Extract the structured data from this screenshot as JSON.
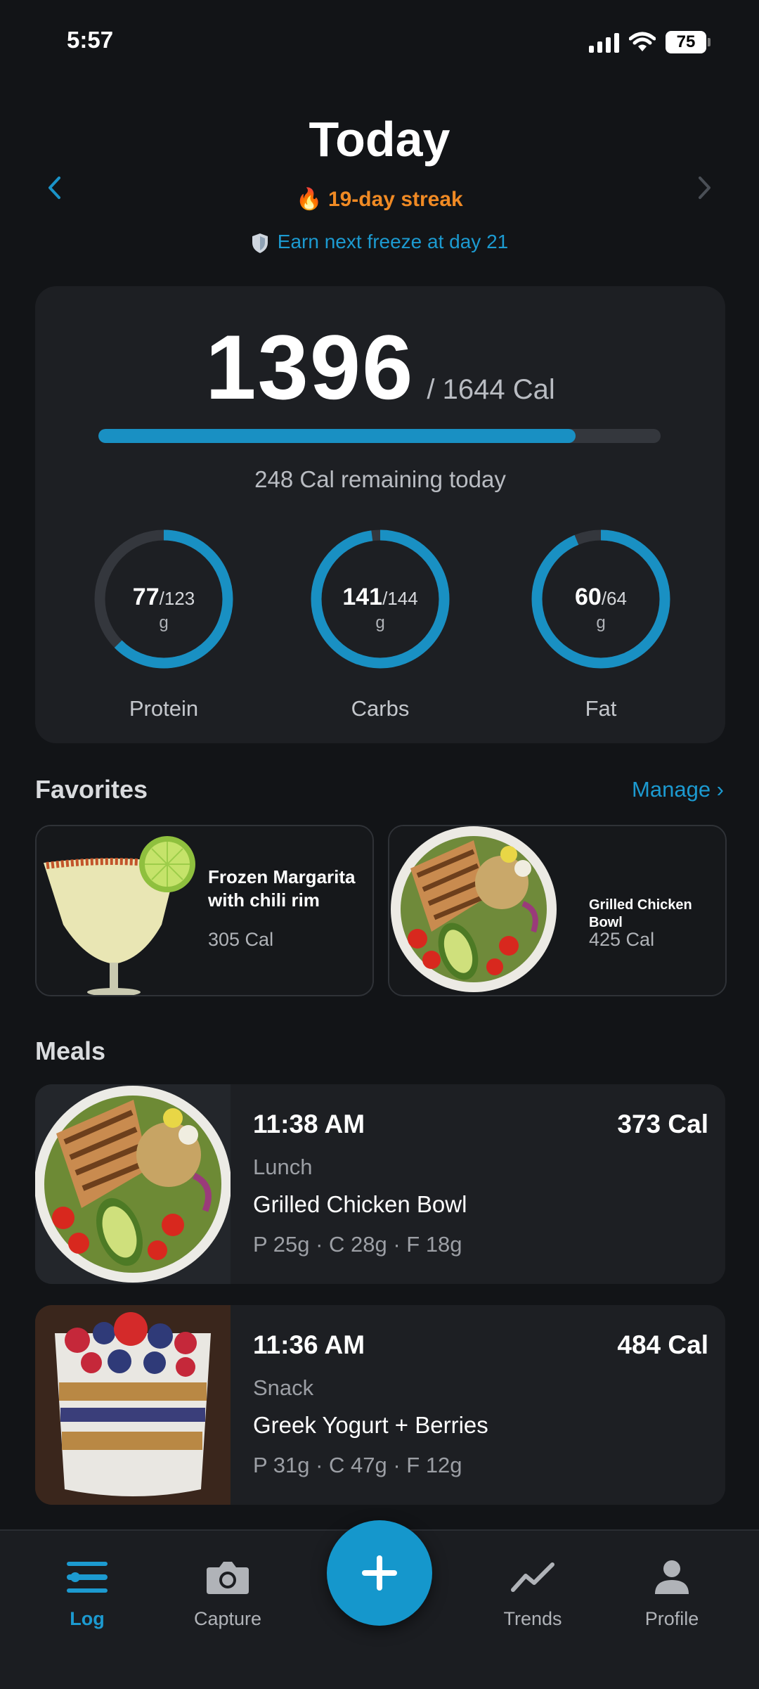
{
  "status_bar": {
    "time": "5:57",
    "battery": "75"
  },
  "header": {
    "title": "Today",
    "streak": "🔥 19-day streak",
    "freeze_note": "Earn next freeze at day 21"
  },
  "summary": {
    "calories_eaten": "1396",
    "calories_goal": "/ 1644 Cal",
    "calorie_progress_fraction": 0.849,
    "remaining": "248 Cal remaining today",
    "macros": [
      {
        "label": "Protein",
        "eaten": "77",
        "goal": "/123",
        "unit": "g",
        "fraction": 0.626
      },
      {
        "label": "Carbs",
        "eaten": "141",
        "goal": "/144",
        "unit": "g",
        "fraction": 0.979
      },
      {
        "label": "Fat",
        "eaten": "60",
        "goal": "/64",
        "unit": "g",
        "fraction": 0.9375
      }
    ],
    "accent_color": "#1990c3"
  },
  "favorites": {
    "title": "Favorites",
    "manage": "Manage ›",
    "items": [
      {
        "name": "Frozen Margarita with chili rim",
        "cal": "305 Cal",
        "image": "margarita-image"
      },
      {
        "name": "Grilled Chicken Bowl",
        "cal": "425 Cal",
        "image": "chicken-bowl-image"
      }
    ]
  },
  "meals": {
    "title": "Meals",
    "items": [
      {
        "time": "11:38 AM",
        "cal": "373 Cal",
        "type": "Lunch",
        "name": "Grilled Chicken Bowl",
        "macros": "P 25g · C 28g · F 18g",
        "image": "chicken-bowl-image"
      },
      {
        "time": "11:36 AM",
        "cal": "484 Cal",
        "type": "Snack",
        "name": "Greek Yogurt + Berries",
        "macros": "P 31g · C 47g · F 12g",
        "image": "yogurt-parfait-image"
      }
    ]
  },
  "tabs": [
    {
      "label": "Log",
      "icon": "log-icon",
      "active": true
    },
    {
      "label": "Capture",
      "icon": "camera-icon",
      "active": false
    },
    {
      "label": "Trends",
      "icon": "trends-icon",
      "active": false
    },
    {
      "label": "Profile",
      "icon": "profile-icon",
      "active": false
    }
  ],
  "fab_icon": "plus-icon"
}
